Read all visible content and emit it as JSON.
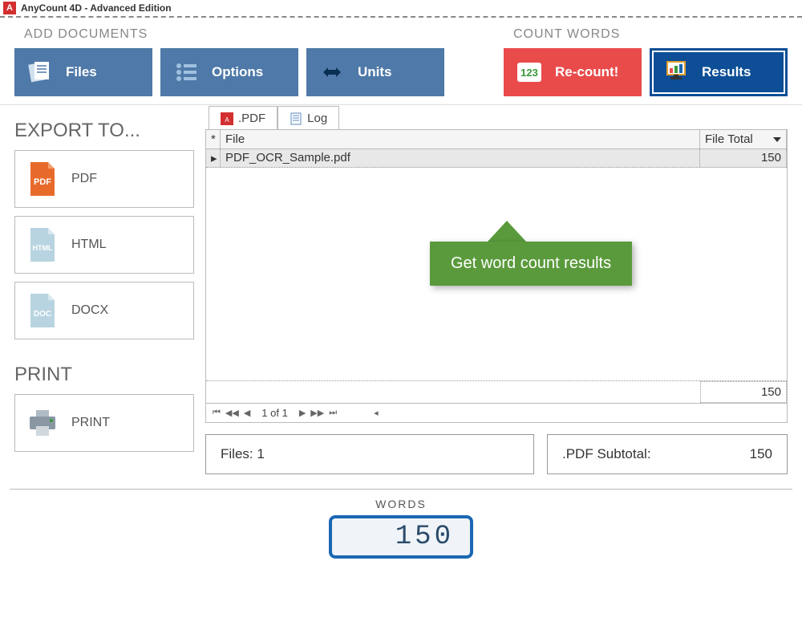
{
  "titlebar": {
    "app_initial": "A",
    "title": "AnyCount 4D - Advanced Edition"
  },
  "ribbon": {
    "group_add": "ADD DOCUMENTS",
    "group_count": "COUNT WORDS",
    "files": "Files",
    "options": "Options",
    "units": "Units",
    "recount": "Re-count!",
    "results": "Results"
  },
  "sidebar": {
    "export_label": "EXPORT TO...",
    "pdf": "PDF",
    "html": "HTML",
    "docx": "DOCX",
    "print_label": "PRINT",
    "print": "PRINT"
  },
  "tabs": {
    "pdf": ".PDF",
    "log": "Log"
  },
  "grid": {
    "header_file": "File",
    "header_total": "File Total",
    "rows": [
      {
        "file": "PDF_OCR_Sample.pdf",
        "total": "150"
      }
    ],
    "footer_total": "150"
  },
  "pager": {
    "text": "1 of 1"
  },
  "summary": {
    "files_label": "Files:",
    "files_count": "1",
    "subtotal_label": ".PDF Subtotal:",
    "subtotal_value": "150"
  },
  "words": {
    "label": "WORDS",
    "value": "150"
  },
  "callout": {
    "text": "Get word count results"
  }
}
